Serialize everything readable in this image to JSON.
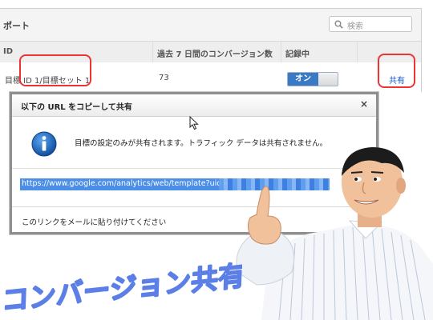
{
  "panel": {
    "title": "ポート",
    "search_placeholder": "検索"
  },
  "table": {
    "headers": [
      "ID",
      "過去 7 日間のコンバージョン数",
      "記録中"
    ],
    "row": {
      "goal": "目標 ID 1/目標セット 1",
      "conversions": "73",
      "recording": "オン",
      "share": "共有"
    }
  },
  "dialog": {
    "title": "以下の URL をコピーして共有",
    "close_label": "×",
    "message": "目標の設定のみが共有されます。トラフィック データは共有されません。",
    "url": "https://www.google.com/analytics/web/template?uid=",
    "footer": "このリンクをメールに貼り付けてください"
  },
  "caption": "コンバージョン共有",
  "colors": {
    "accent_blue": "#3a79c4",
    "link_blue": "#1155cc",
    "highlight_red": "#e33333",
    "handwriting_blue": "#5b7fe6"
  }
}
